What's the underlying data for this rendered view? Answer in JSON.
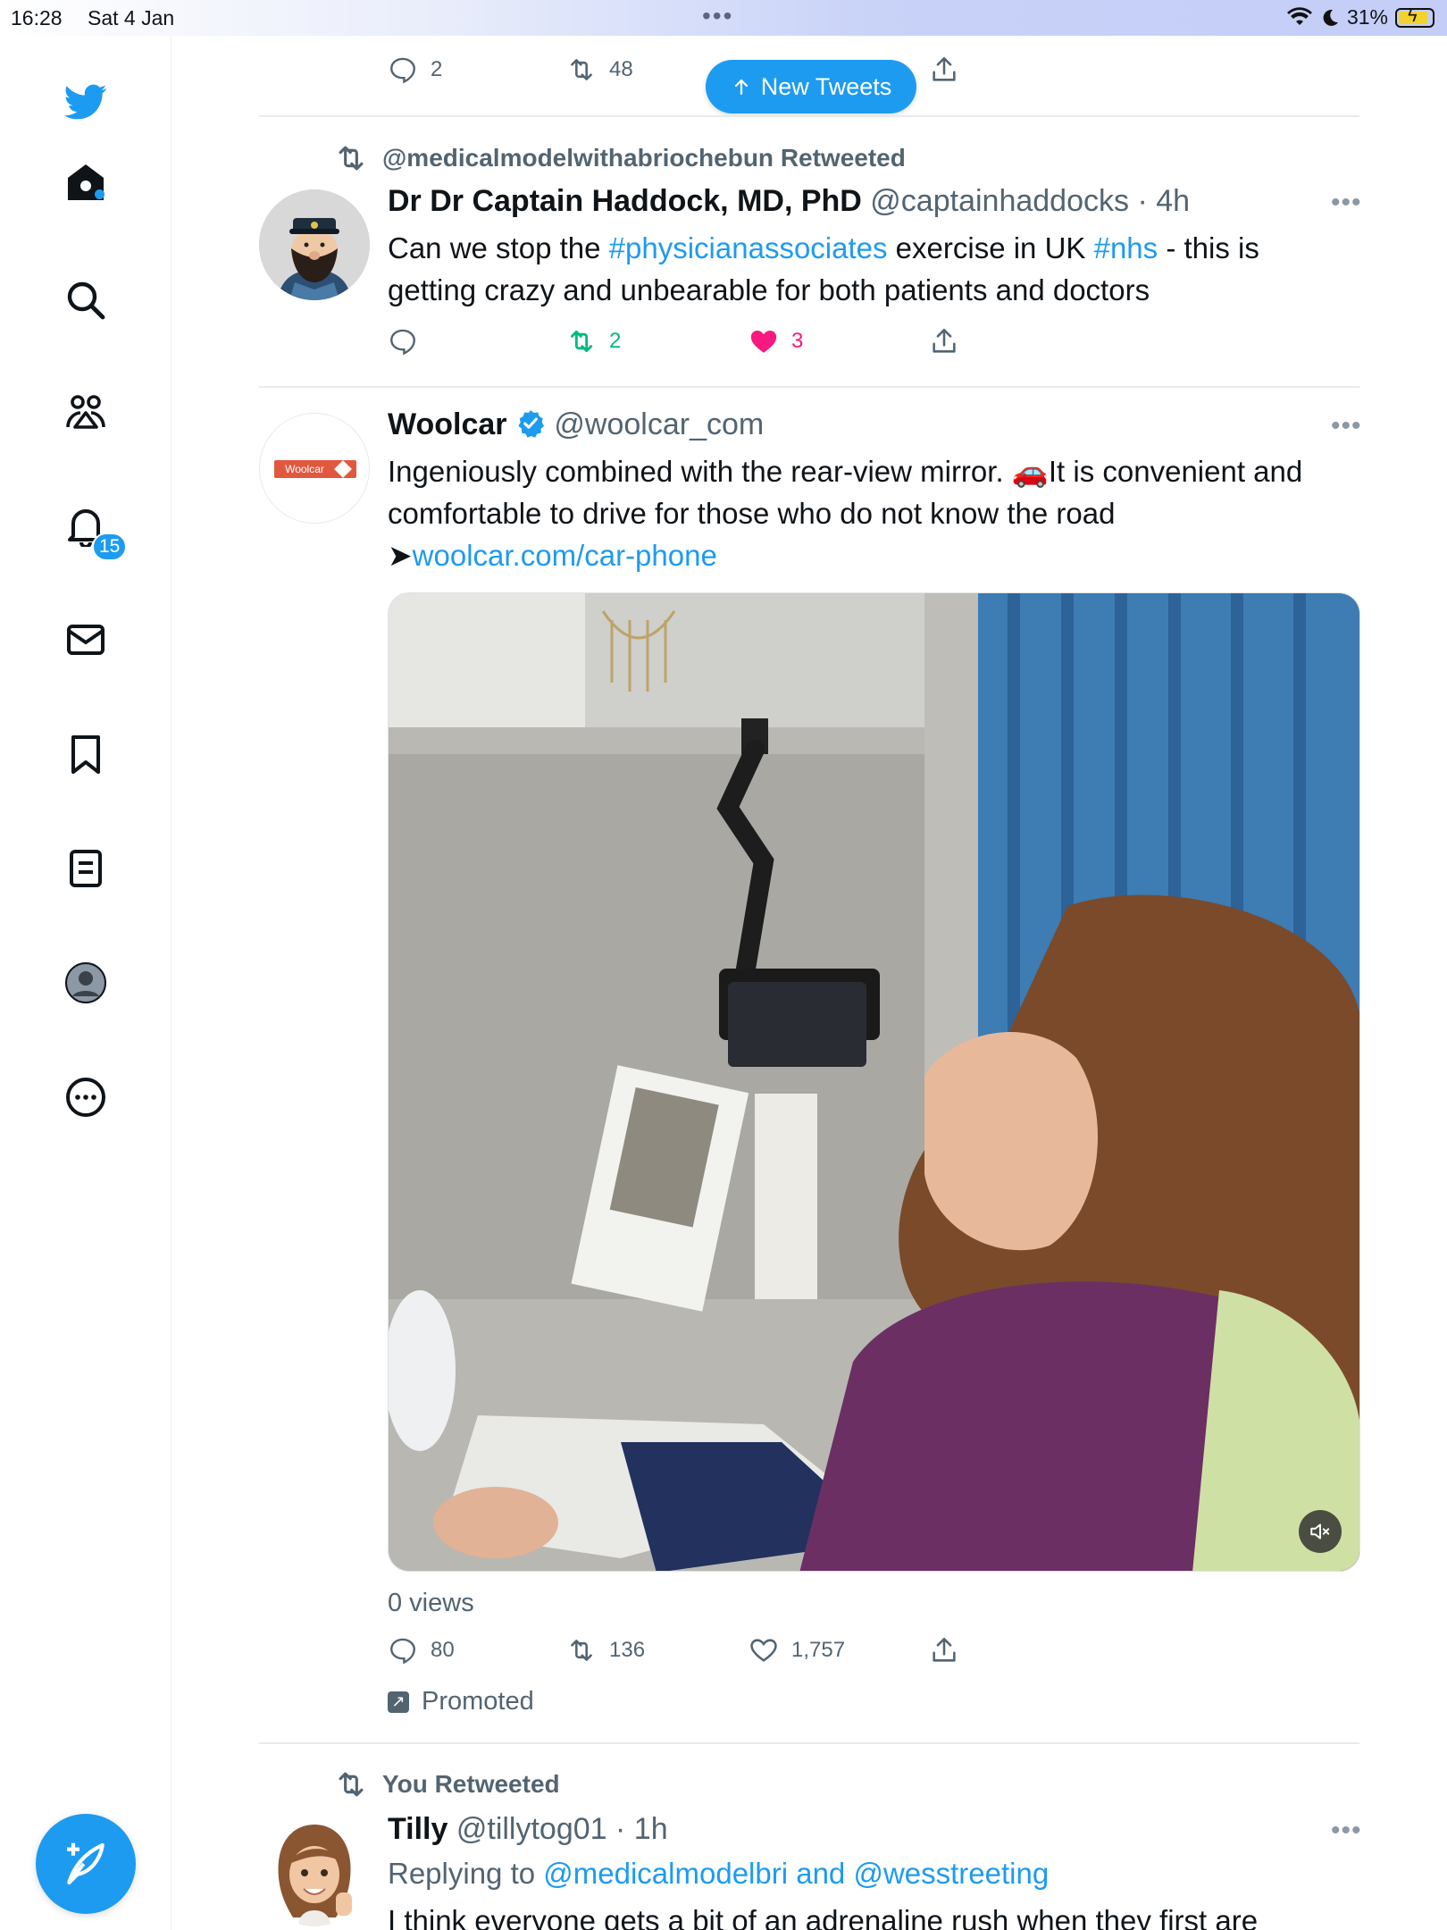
{
  "status_bar": {
    "time": "16:28",
    "date": "Sat 4 Jan",
    "battery": "31%"
  },
  "sidebar": {
    "notifications_badge": "15",
    "accent_color": "#1d9bf0"
  },
  "top_tweet_actions": {
    "replies": "2",
    "retweets": "48"
  },
  "new_tweets_button": "New Tweets",
  "tweets": [
    {
      "retweeted_by": "@medicalmodelwithabriochebun Retweeted",
      "name": "Dr Dr Captain Haddock, MD, PhD",
      "handle": "@captainhaddocks",
      "time": "· 4h",
      "text_parts": {
        "a": "Can we stop the ",
        "hashtag1": "#physicianassociates",
        "b": " exercise in UK ",
        "hashtag2": "#nhs",
        "c": " - this is getting crazy and unbearable for both patients and doctors"
      },
      "retweets": "2",
      "likes": "3"
    },
    {
      "name": "Woolcar",
      "handle": "@woolcar_com",
      "avatar_text": "Woolcar",
      "text_parts": {
        "a": "Ingeniously combined with the rear-view mirror. 🚗It is convenient and comfortable to drive for those who do not know the road",
        "arrow": "➤",
        "link": "woolcar.com/car-phone"
      },
      "views": "0 views",
      "replies": "80",
      "retweets": "136",
      "likes": "1,757",
      "promoted": "Promoted"
    },
    {
      "retweeted_by": "You Retweeted",
      "name": "Tilly",
      "handle": "@tillytog01",
      "time": "· 1h",
      "replying_prefix": "Replying to",
      "replying_to": "@medicalmodelbri and @wesstreeting",
      "text": "I think everyone gets a bit of an adrenaline rush when they first are"
    }
  ]
}
